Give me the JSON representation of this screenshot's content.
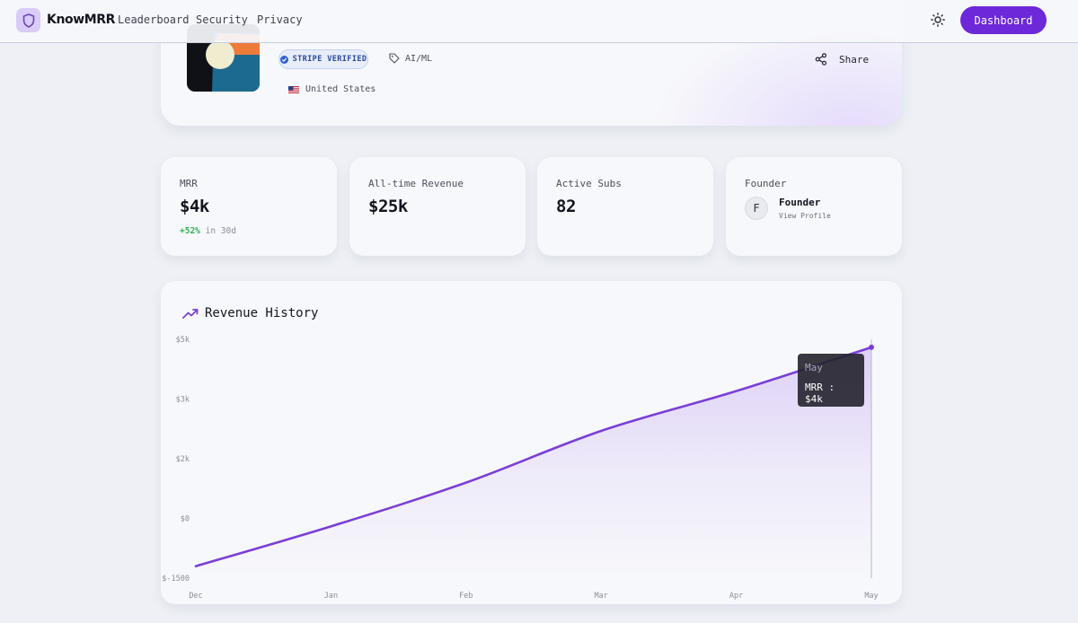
{
  "navbar": {
    "brand": "KnowMRR",
    "links": [
      "Leaderboard",
      "Security",
      "Privacy"
    ],
    "dashboard_label": "Dashboard"
  },
  "startup": {
    "verified_badge": "STRIPE VERIFIED",
    "category": "AI/ML",
    "country": "United States",
    "share_label": "Share"
  },
  "stats": {
    "mrr": {
      "label": "MRR",
      "value": "$4k",
      "change": "+52%",
      "change_suffix": "in 30d"
    },
    "revenue": {
      "label": "All-time Revenue",
      "value": "$25k"
    },
    "subs": {
      "label": "Active Subs",
      "value": "82"
    },
    "founder": {
      "label": "Founder",
      "initial": "F",
      "name": "Founder",
      "link": "View Profile"
    }
  },
  "chart": {
    "title": "Revenue History",
    "tooltip": {
      "label": "May",
      "series": "MRR",
      "value": "$4k"
    }
  },
  "chart_data": {
    "type": "area",
    "title": "Revenue History",
    "xlabel": "",
    "ylabel": "",
    "categories": [
      "Dec",
      "Jan",
      "Feb",
      "Mar",
      "Apr",
      "May"
    ],
    "y_tick_labels": [
      "$5k",
      "$3k",
      "$2k",
      "$0",
      "$-1500"
    ],
    "y_tick_values": [
      5000,
      3500,
      2000,
      500,
      -1000
    ],
    "ylim": [
      -1000,
      5000
    ],
    "series": [
      {
        "name": "MRR",
        "x": [
          0,
          1,
          2,
          3,
          4,
          5
        ],
        "values": [
          -700,
          300,
          1400,
          2700,
          3700,
          4800
        ]
      }
    ],
    "grid": false,
    "colors": {
      "line": "#7a3fd6",
      "fill": "#b99af0"
    }
  },
  "colors": {
    "accent": "#6d28d9",
    "verified": "#2f5fd2",
    "positive": "#2fae55"
  },
  "icons": {
    "logo": "shield-icon",
    "theme": "sun-icon",
    "verified": "check-circle-icon",
    "tag": "tag-icon",
    "share": "share-icon",
    "chart": "trending-up-icon"
  }
}
